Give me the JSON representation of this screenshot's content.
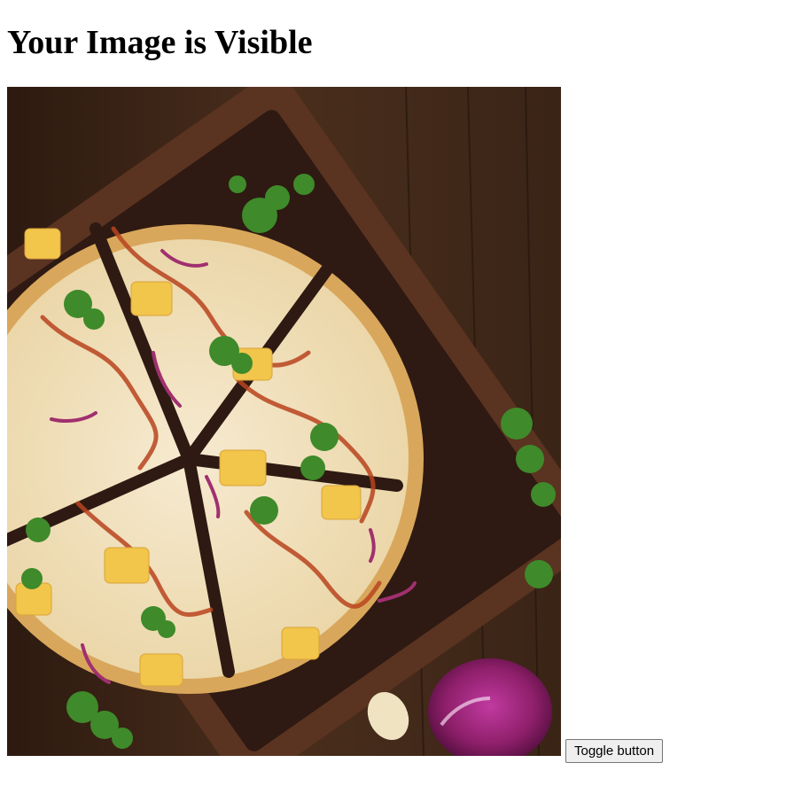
{
  "page": {
    "heading": "Your Image is Visible",
    "toggle_button_label": "Toggle button"
  },
  "image": {
    "subject": "pizza-on-wooden-board",
    "colors": {
      "table_wood": "#3b2618",
      "board_wood": "#5a3321",
      "board_inner": "#2e1a12",
      "crust": "#e0b36a",
      "cheese": "#f3e6c8",
      "sauce": "#b8441f",
      "pineapple": "#f2c54b",
      "cilantro": "#3f8a2a",
      "red_onion": "#8e1f6a"
    }
  }
}
